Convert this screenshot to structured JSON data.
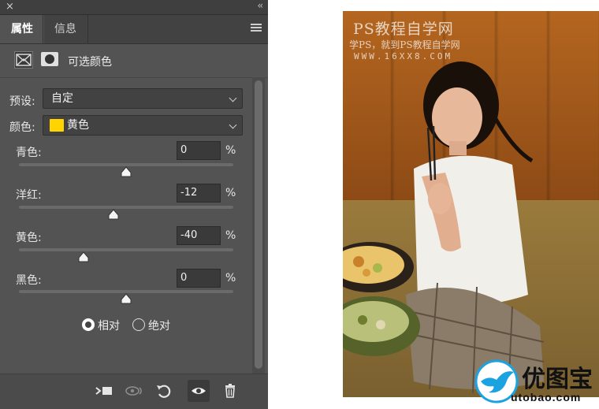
{
  "panel": {
    "close_glyph": "×",
    "collapse_glyph": "‹‹",
    "tabs": [
      {
        "label": "属性",
        "active": true
      },
      {
        "label": "信息",
        "active": false
      }
    ],
    "header_title": "可选颜色",
    "preset": {
      "label": "预设:",
      "value": "自定"
    },
    "colors": {
      "label": "颜色:",
      "value": "黄色",
      "swatch_color": "#ffd400"
    },
    "sliders": [
      {
        "label": "青色:",
        "value": "0",
        "unit": "%",
        "level": 0
      },
      {
        "label": "洋红:",
        "value": "-12",
        "unit": "%",
        "level": -12
      },
      {
        "label": "黄色:",
        "value": "-40",
        "unit": "%",
        "level": -40
      },
      {
        "label": "黑色:",
        "value": "0",
        "unit": "%",
        "level": 0
      }
    ],
    "slider_range": [
      -100,
      100
    ],
    "method": {
      "options": [
        "相对",
        "绝对"
      ],
      "selected": "相对"
    },
    "footer_icons": [
      "clip-to-layer-icon",
      "view-previous-icon",
      "reset-icon",
      "visibility-eye-icon",
      "trash-icon"
    ]
  },
  "photo": {
    "watermark_title": "PS教程自学网",
    "watermark_subtitle": "学PS，就到PS教程自学网",
    "watermark_url": "WWW.16XX8.COM"
  },
  "logo": {
    "name": "优图宝",
    "url": "utobao.com",
    "brand_color": "#1aa3e0"
  }
}
